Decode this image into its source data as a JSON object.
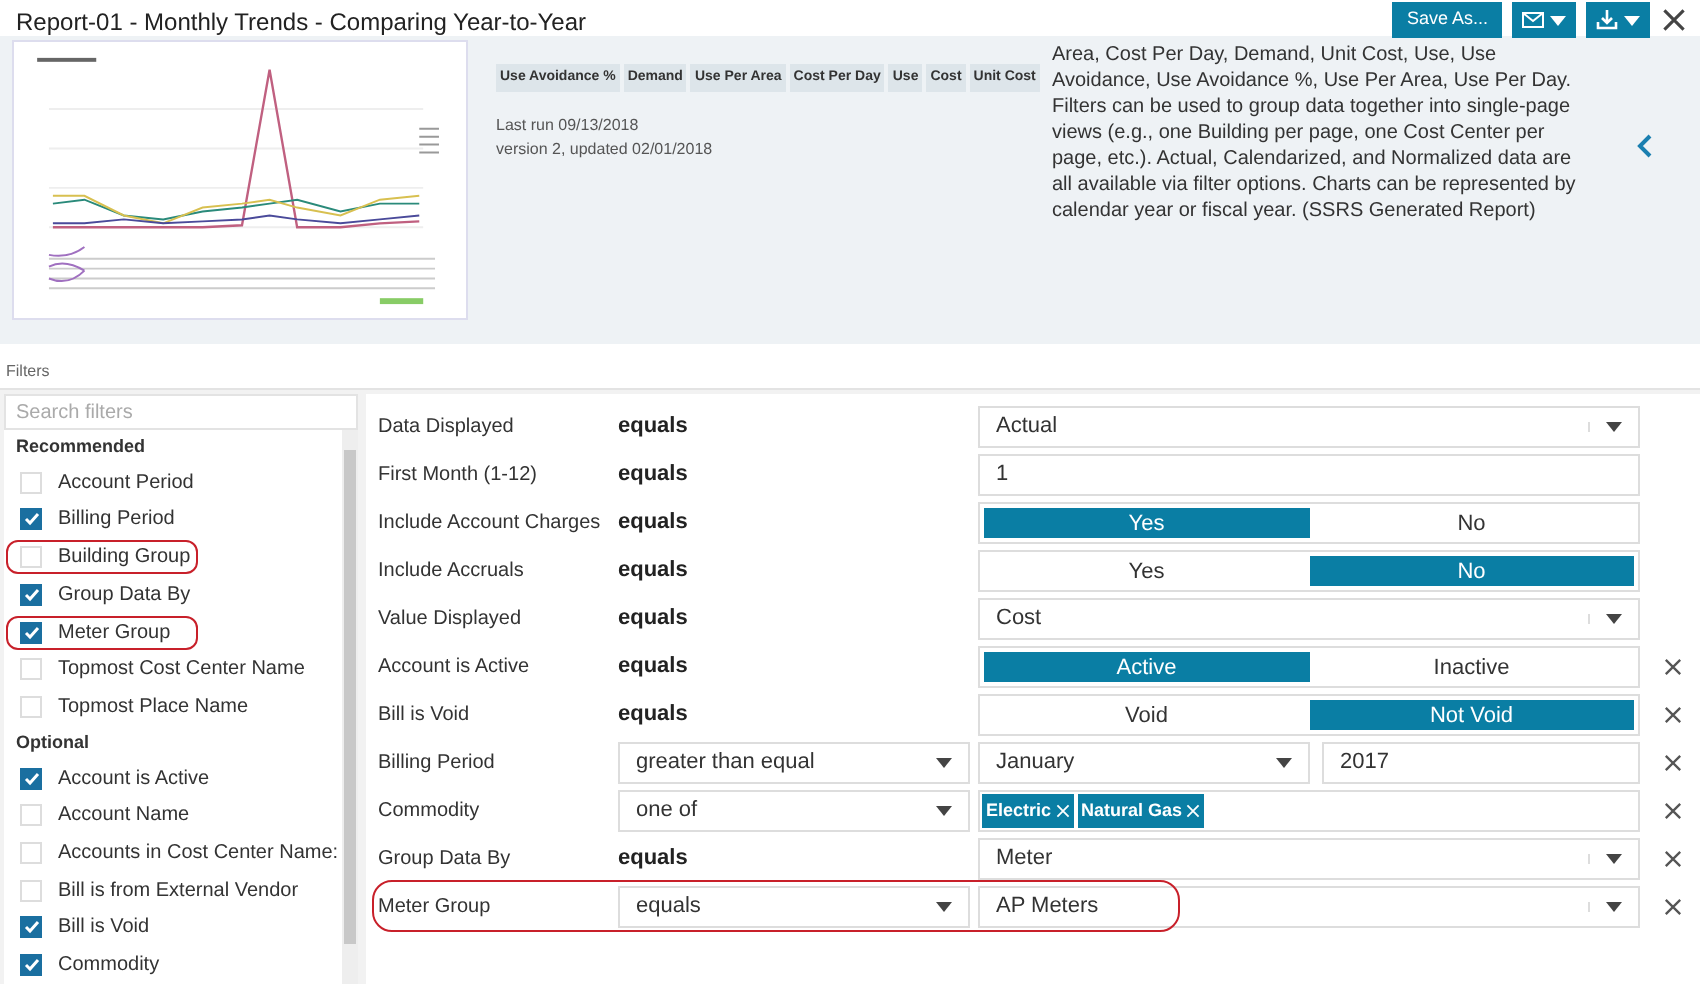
{
  "window": {
    "title": "Report-01 - Monthly Trends - Comparing Year-to-Year"
  },
  "toolbar": {
    "save_label": "Save As..."
  },
  "report": {
    "tags": [
      "Use Avoidance %",
      "Demand",
      "Use Per Area",
      "Cost Per Day",
      "Use",
      "Cost",
      "Unit Cost"
    ],
    "last_run": "Last run 09/13/2018",
    "version": "version 2, updated 02/01/2018",
    "description": "Area, Cost Per Day, Demand, Unit Cost, Use, Use Avoidance, Use Avoidance %, Use Per Area, Use Per Day. Filters can be used to group data together into single-page views (e.g., one Building per page, one Cost Center per page, etc.). Actual, Calendarized, and Normalized data are all available via filter options. Charts can be represented by calendar year or fiscal year. (SSRS Generated Report)"
  },
  "filters": {
    "heading": "Filters",
    "search": {
      "placeholder": "Search filters"
    },
    "sections": [
      {
        "title": "Recommended",
        "items": [
          {
            "label": "Account Period",
            "checked": false,
            "highlighted": false
          },
          {
            "label": "Billing Period",
            "checked": true,
            "highlighted": false
          },
          {
            "label": "Building Group",
            "checked": false,
            "highlighted": true
          },
          {
            "label": "Group Data By",
            "checked": true,
            "highlighted": false
          },
          {
            "label": "Meter Group",
            "checked": true,
            "highlighted": true
          },
          {
            "label": "Topmost Cost Center Name",
            "checked": false,
            "highlighted": false
          },
          {
            "label": "Topmost Place Name",
            "checked": false,
            "highlighted": false
          }
        ]
      },
      {
        "title": "Optional",
        "items": [
          {
            "label": "Account is Active",
            "checked": true,
            "highlighted": false
          },
          {
            "label": "Account Name",
            "checked": false,
            "highlighted": false
          },
          {
            "label": "Accounts in Cost Center Name:",
            "checked": false,
            "highlighted": false
          },
          {
            "label": "Bill is from External Vendor",
            "checked": false,
            "highlighted": false
          },
          {
            "label": "Bill is Void",
            "checked": true,
            "highlighted": false
          },
          {
            "label": "Commodity",
            "checked": true,
            "highlighted": false
          }
        ]
      }
    ],
    "rows": [
      {
        "label": "Data Displayed",
        "operator": {
          "kind": "text",
          "text": "equals"
        },
        "value": {
          "kind": "select",
          "text": "Actual"
        },
        "removable": false,
        "highlighted": false
      },
      {
        "label": "First Month (1-12)",
        "operator": {
          "kind": "text",
          "text": "equals"
        },
        "value": {
          "kind": "input",
          "text": "1"
        },
        "removable": false,
        "highlighted": false
      },
      {
        "label": "Include Account Charges",
        "operator": {
          "kind": "text",
          "text": "equals"
        },
        "value": {
          "kind": "toggle",
          "options": [
            {
              "label": "Yes",
              "selected": true
            },
            {
              "label": "No",
              "selected": false
            }
          ]
        },
        "removable": false,
        "highlighted": false
      },
      {
        "label": "Include Accruals",
        "operator": {
          "kind": "text",
          "text": "equals"
        },
        "value": {
          "kind": "toggle",
          "options": [
            {
              "label": "Yes",
              "selected": false
            },
            {
              "label": "No",
              "selected": true
            }
          ]
        },
        "removable": false,
        "highlighted": false
      },
      {
        "label": "Value Displayed",
        "operator": {
          "kind": "text",
          "text": "equals"
        },
        "value": {
          "kind": "select",
          "text": "Cost"
        },
        "removable": false,
        "highlighted": false
      },
      {
        "label": "Account is Active",
        "operator": {
          "kind": "text",
          "text": "equals"
        },
        "value": {
          "kind": "toggle",
          "options": [
            {
              "label": "Active",
              "selected": true
            },
            {
              "label": "Inactive",
              "selected": false
            }
          ]
        },
        "removable": true,
        "highlighted": false
      },
      {
        "label": "Bill is Void",
        "operator": {
          "kind": "text",
          "text": "equals"
        },
        "value": {
          "kind": "toggle",
          "options": [
            {
              "label": "Void",
              "selected": false
            },
            {
              "label": "Not Void",
              "selected": true
            }
          ]
        },
        "removable": true,
        "highlighted": false
      },
      {
        "label": "Billing Period",
        "operator": {
          "kind": "select",
          "text": "greater than equal"
        },
        "value": {
          "kind": "period",
          "text": "January",
          "year": "2017"
        },
        "removable": true,
        "highlighted": false
      },
      {
        "label": "Commodity",
        "operator": {
          "kind": "select",
          "text": "one of"
        },
        "value": {
          "kind": "tags",
          "tags": [
            "Electric",
            "Natural Gas"
          ]
        },
        "removable": true,
        "highlighted": false
      },
      {
        "label": "Group Data By",
        "operator": {
          "kind": "text",
          "text": "equals"
        },
        "value": {
          "kind": "select",
          "text": "Meter"
        },
        "removable": true,
        "highlighted": false
      },
      {
        "label": "Meter Group",
        "operator": {
          "kind": "select",
          "text": "equals"
        },
        "value": {
          "kind": "select",
          "text": "AP Meters"
        },
        "removable": true,
        "highlighted": true
      }
    ]
  }
}
